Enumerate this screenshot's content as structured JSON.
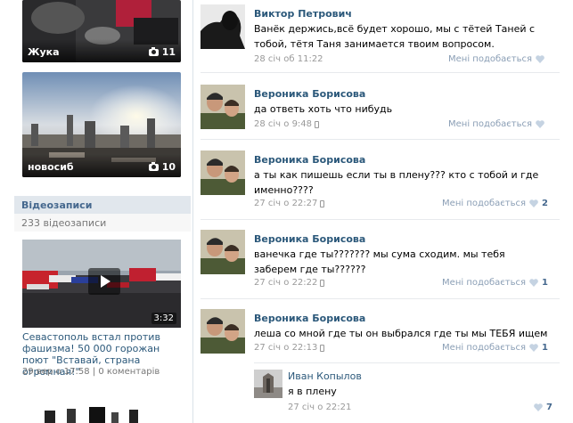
{
  "albums": [
    {
      "name": "Жука",
      "count": "11"
    },
    {
      "name": "новосиб",
      "count": "10"
    }
  ],
  "videos": {
    "header": "Відеозаписи",
    "count_text": "233 відеозаписи",
    "item": {
      "duration": "3:32",
      "title": "Севастополь встал против фашизма! 50 000 горожан поют \"Вставай, страна огромная!\"",
      "date": "29 вер о 17:58",
      "separator": "|",
      "comments": "0 коментарів"
    }
  },
  "comments": [
    {
      "author": "Виктор Петрович",
      "text": "Ванёк держись,всё будет хорошо, мы с тётей Таней с тобой, тётя Таня занимается твоим вопросом.",
      "date": "28 січ об 11:22",
      "like_label": "Мені подобається",
      "likes": ""
    },
    {
      "author": "Вероника Борисова",
      "text": "да ответь хоть что нибудь",
      "date": "28 січ о 9:48",
      "like_label": "Мені подобається",
      "likes": ""
    },
    {
      "author": "Вероника Борисова",
      "text": "а ты как пишешь если ты в плену??? кто с тобой и где именно????",
      "date": "27 січ о 22:27",
      "like_label": "Мені подобається",
      "likes": "2"
    },
    {
      "author": "Вероника Борисова",
      "text": "ванечка где ты??????? мы сума сходим. мы тебя заберем где ты??????",
      "date": "27 січ о 22:22",
      "like_label": "Мені подобається",
      "likes": "1"
    },
    {
      "author": "Вероника Борисова",
      "text": "леша со мной где ты он выбрался где ты мы ТЕБЯ ищем",
      "date": "27 січ о 22:13",
      "like_label": "Мені подобається",
      "likes": "1"
    }
  ],
  "reply": {
    "author": "Иван Копылов",
    "text": "я в плену",
    "date": "27 січ о 22:21",
    "likes": "7"
  },
  "colors": {
    "link": "#2b587a",
    "header_bg": "#e1e7ed",
    "heart": "#c5d3e2"
  }
}
